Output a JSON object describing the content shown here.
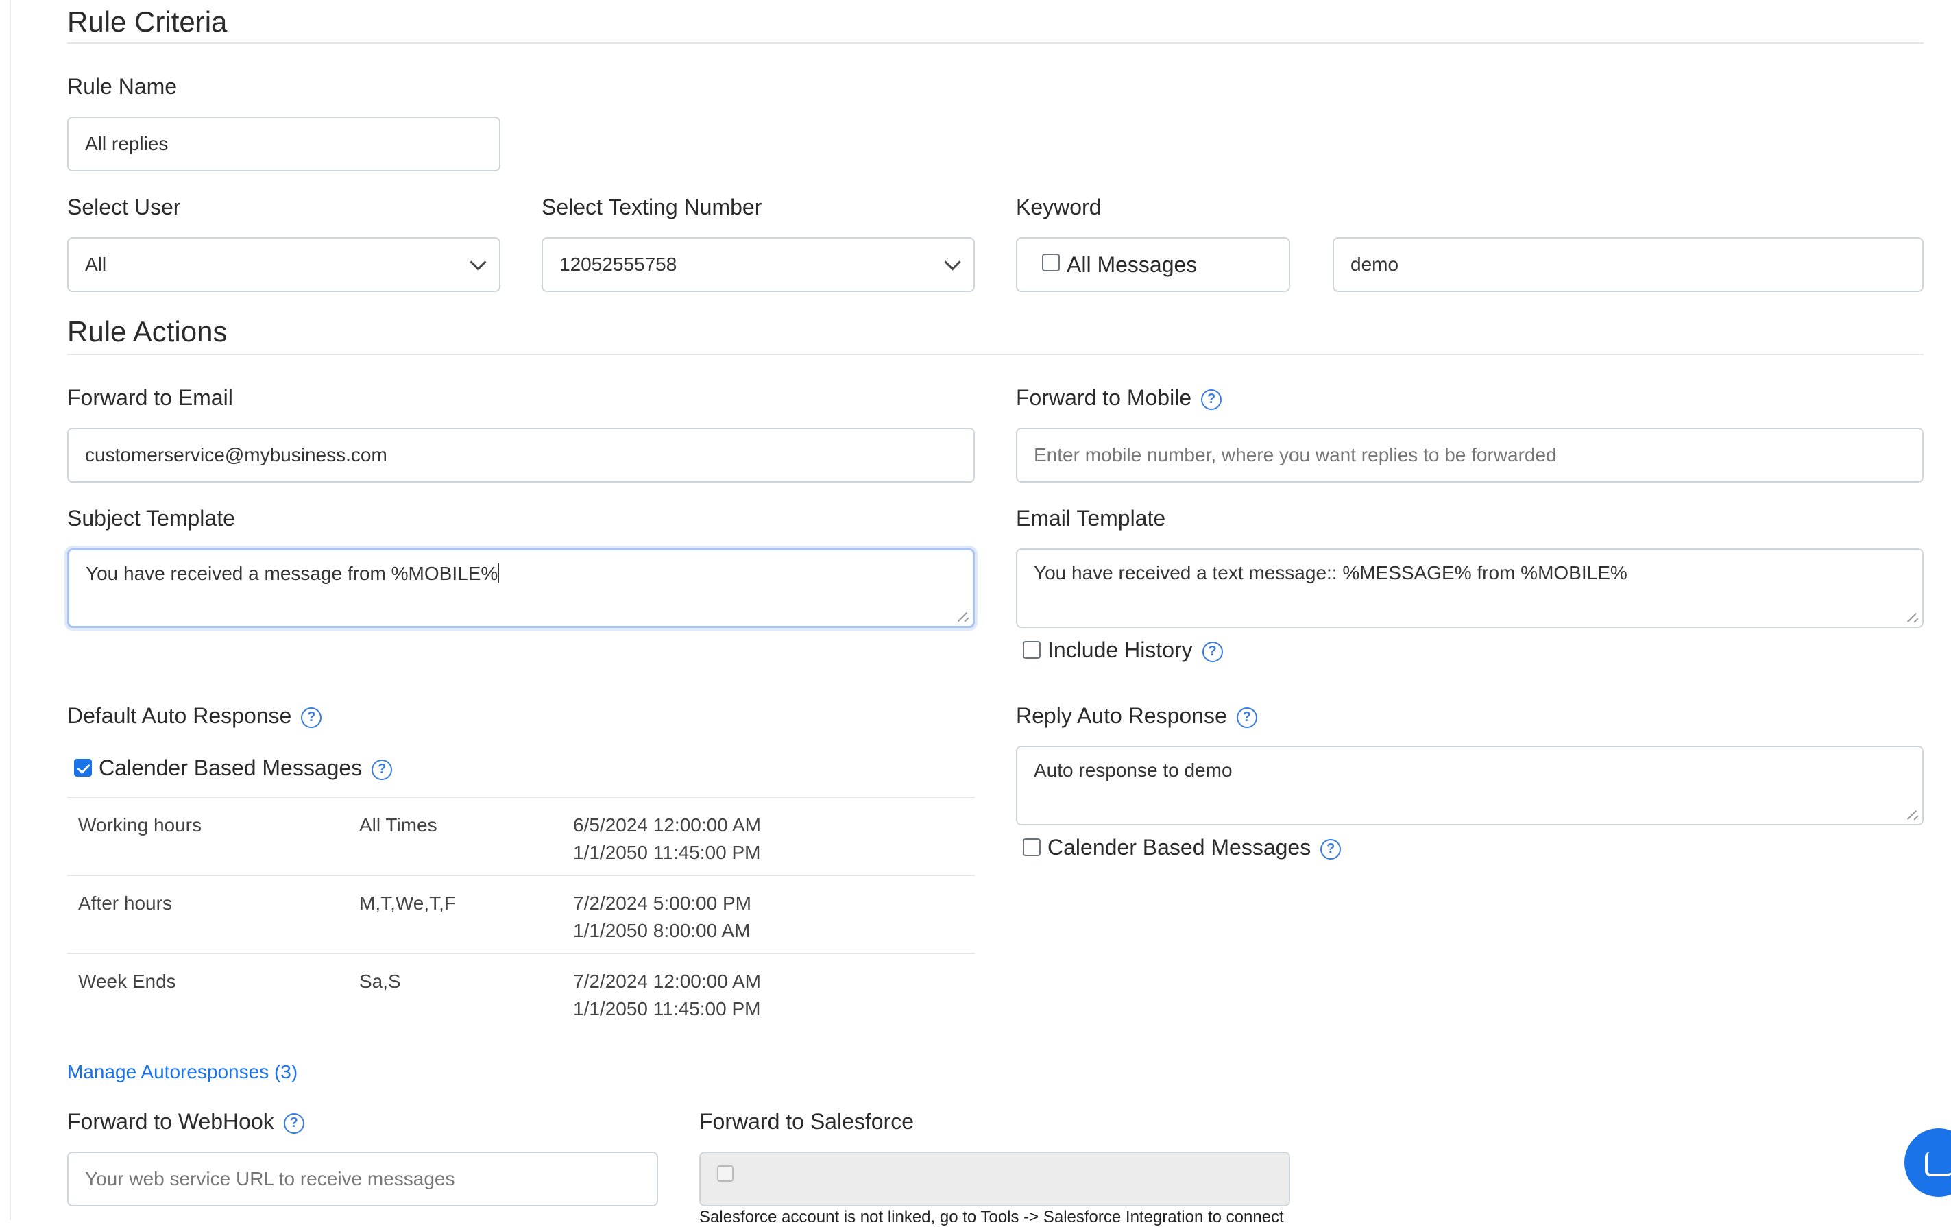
{
  "criteria": {
    "heading": "Rule Criteria",
    "rule_name_label": "Rule Name",
    "rule_name_value": "All replies",
    "select_user_label": "Select User",
    "select_user_value": "All",
    "texting_number_label": "Select Texting Number",
    "texting_number_value": "12052555758",
    "keyword_label": "Keyword",
    "all_messages_label": "All Messages",
    "keyword_value": "demo"
  },
  "actions": {
    "heading": "Rule Actions",
    "forward_email_label": "Forward to Email",
    "forward_email_value": "customerservice@mybusiness.com",
    "forward_mobile_label": "Forward to Mobile",
    "forward_mobile_placeholder": "Enter mobile number, where you want replies to be forwarded",
    "subject_label": "Subject Template",
    "subject_value": "You have received a message from %MOBILE%",
    "email_template_label": "Email Template",
    "email_template_value": "You have received a text message:: %MESSAGE% from %MOBILE%",
    "include_history_label": "Include History",
    "default_auto_label": "Default Auto Response",
    "calendar_label": "Calender Based Messages",
    "reply_auto_label": "Reply Auto Response",
    "reply_auto_value": "Auto response to demo",
    "reply_calendar_label": "Calender Based Messages",
    "schedule": [
      {
        "name": "Working hours",
        "days": "All Times",
        "start": "6/5/2024 12:00:00 AM",
        "end": "1/1/2050 11:45:00 PM"
      },
      {
        "name": "After hours",
        "days": "M,T,We,T,F",
        "start": "7/2/2024 5:00:00 PM",
        "end": "1/1/2050 8:00:00 AM"
      },
      {
        "name": "Week Ends",
        "days": "Sa,S",
        "start": "7/2/2024 12:00:00 AM",
        "end": "1/1/2050 11:45:00 PM"
      }
    ],
    "manage_link": "Manage Autoresponses (3)",
    "webhook_label": "Forward to WebHook",
    "webhook_placeholder": "Your web service URL to receive messages",
    "salesforce_label": "Forward to Salesforce",
    "salesforce_note": "Salesforce account is not linked, go to Tools -> Salesforce Integration to connect"
  },
  "icons": {
    "help": "question-circle-icon",
    "chat": "chat-bubble-icon",
    "dropdown": "chevron-down-icon"
  },
  "colors": {
    "accent": "#1a73e8",
    "border": "#cfd4da",
    "focus": "#a9c4f2"
  }
}
